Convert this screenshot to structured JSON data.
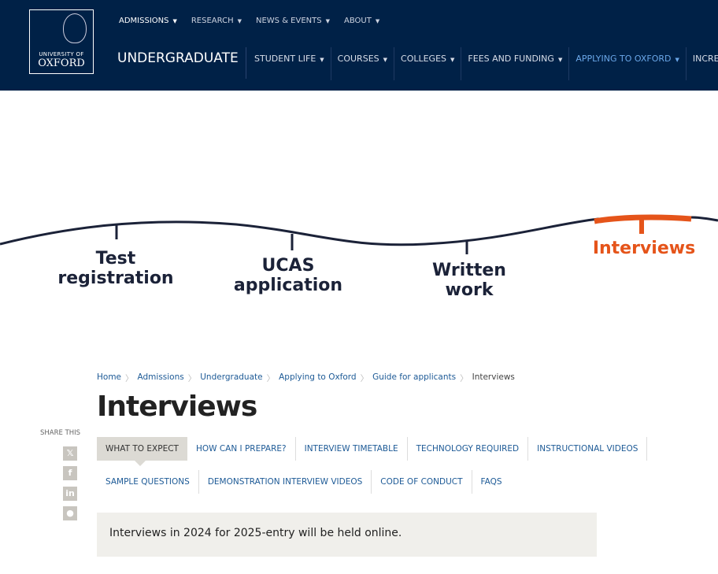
{
  "logo": {
    "line1": "UNIVERSITY OF",
    "line2": "OXFORD"
  },
  "top_nav": [
    {
      "label": "ADMISSIONS",
      "active": true
    },
    {
      "label": "RESEARCH"
    },
    {
      "label": "NEWS & EVENTS"
    },
    {
      "label": "ABOUT"
    }
  ],
  "section_title": "UNDERGRADUATE",
  "sub_nav": [
    {
      "label": "STUDENT LIFE"
    },
    {
      "label": "COURSES"
    },
    {
      "label": "COLLEGES"
    },
    {
      "label": "FEES AND FUNDING"
    },
    {
      "label": "APPLYING TO OXFORD",
      "active": true
    },
    {
      "label": "INCREA"
    }
  ],
  "timeline": {
    "steps": [
      {
        "l1": "Test",
        "l2": "registration"
      },
      {
        "l1": "UCAS",
        "l2": "application"
      },
      {
        "l1": "Written",
        "l2": "work"
      },
      {
        "l1": "Interviews",
        "active": true
      }
    ],
    "accent": "#e5541a",
    "line_color": "#1b2238"
  },
  "breadcrumb": [
    "Home",
    "Admissions",
    "Undergraduate",
    "Applying to Oxford",
    "Guide for applicants",
    "Interviews"
  ],
  "page_title": "Interviews",
  "share": {
    "label": "SHARE THIS",
    "icons": [
      "x-icon",
      "facebook-icon",
      "linkedin-icon",
      "reddit-icon"
    ],
    "glyphs": [
      "𝕏",
      "f",
      "in",
      "●"
    ]
  },
  "tabs_row1": [
    "WHAT TO EXPECT",
    "HOW CAN I PREPARE?",
    "INTERVIEW TIMETABLE",
    "TECHNOLOGY REQUIRED",
    "INSTRUCTIONAL VIDEOS"
  ],
  "tabs_row2": [
    "SAMPLE QUESTIONS",
    "DEMONSTRATION INTERVIEW VIDEOS",
    "CODE OF CONDUCT",
    "FAQS"
  ],
  "notice": "Interviews in 2024 for 2025-entry will be held online."
}
